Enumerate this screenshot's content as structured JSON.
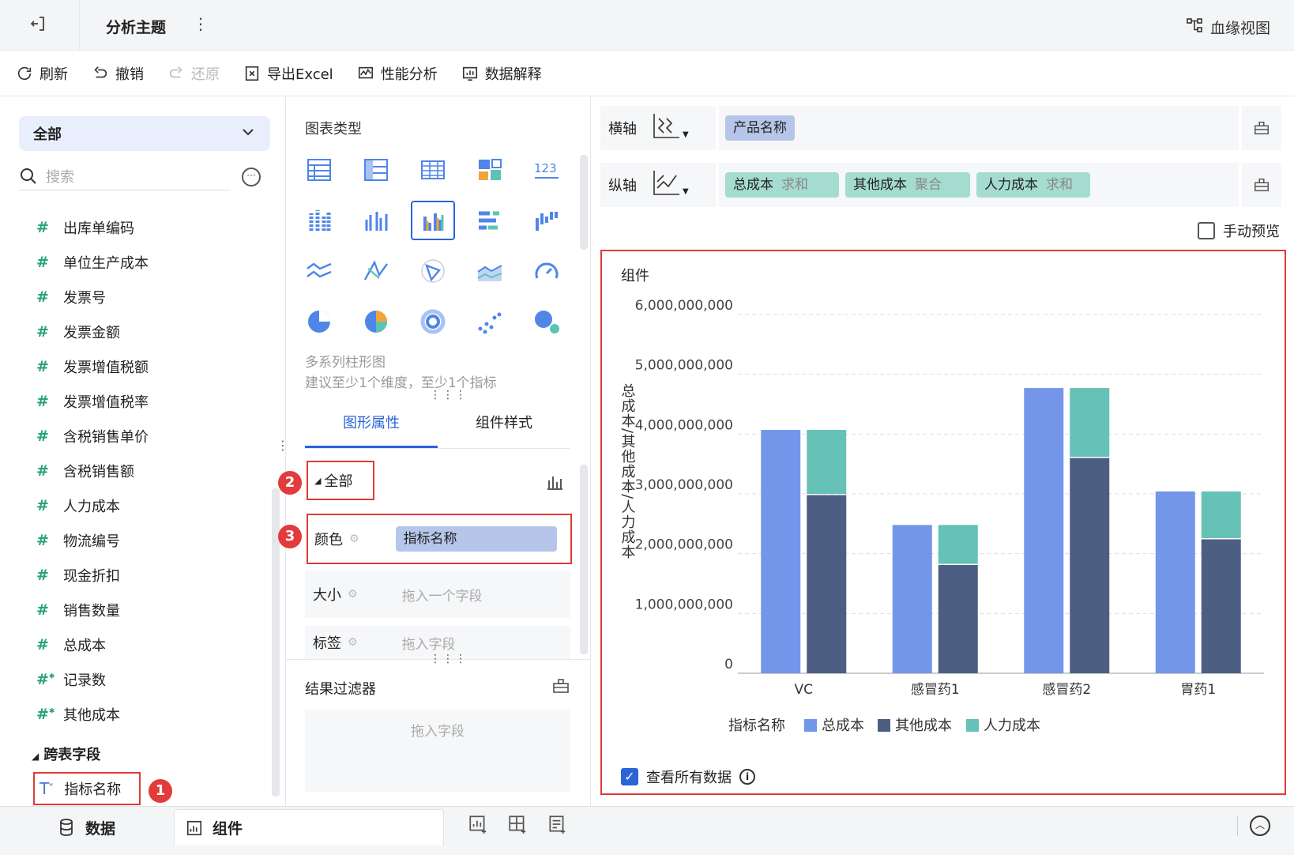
{
  "header": {
    "title": "分析主题",
    "lineage_label": "血缘视图"
  },
  "toolbar": {
    "refresh": "刷新",
    "undo": "撤销",
    "redo": "还原",
    "export": "导出Excel",
    "perf": "性能分析",
    "explain": "数据解释"
  },
  "left": {
    "scope": "全部",
    "search_placeholder": "搜索",
    "fields": [
      {
        "label": "出库单编码",
        "icon": "hash-icon"
      },
      {
        "label": "单位生产成本",
        "icon": "hash-icon"
      },
      {
        "label": "发票号",
        "icon": "hash-icon"
      },
      {
        "label": "发票金额",
        "icon": "hash-icon"
      },
      {
        "label": "发票增值税额",
        "icon": "hash-icon"
      },
      {
        "label": "发票增值税率",
        "icon": "hash-icon"
      },
      {
        "label": "含税销售单价",
        "icon": "hash-icon"
      },
      {
        "label": "含税销售额",
        "icon": "hash-icon"
      },
      {
        "label": "人力成本",
        "icon": "hash-icon"
      },
      {
        "label": "物流编号",
        "icon": "hash-icon"
      },
      {
        "label": "现金折扣",
        "icon": "hash-icon"
      },
      {
        "label": "销售数量",
        "icon": "hash-icon"
      },
      {
        "label": "总成本",
        "icon": "hash-icon"
      },
      {
        "label": "记录数",
        "icon": "hash-calc-icon"
      },
      {
        "label": "其他成本",
        "icon": "hash-calc-icon"
      }
    ],
    "cross_table_title": "跨表字段",
    "cross_field": "指标名称",
    "badge1": "1"
  },
  "middle": {
    "chart_type_title": "图表类型",
    "chart_desc": "多系列柱形图",
    "chart_hint": "建议至少1个维度，至少1个指标",
    "tab_graph": "图形属性",
    "tab_style": "组件样式",
    "all_label": "全部",
    "badge2": "2",
    "badge3": "3",
    "color_label": "颜色",
    "color_value": "指标名称",
    "size_label": "大小",
    "size_placeholder": "拖入一个字段",
    "tag_label": "标签",
    "tag_placeholder": "拖入字段",
    "filter_title": "结果过滤器",
    "filter_placeholder": "拖入字段"
  },
  "right": {
    "x_axis_label": "横轴",
    "x_field": "产品名称",
    "y_axis_label": "纵轴",
    "y_fields": [
      {
        "name": "总成本",
        "agg": "求和"
      },
      {
        "name": "其他成本",
        "agg": "聚合"
      },
      {
        "name": "人力成本",
        "agg": "求和"
      }
    ],
    "manual_preview": "手动预览",
    "component_title": "组件",
    "view_all": "查看所有数据"
  },
  "bottom": {
    "data_tab": "数据",
    "component_tab": "组件"
  },
  "colors": {
    "total": "#7396ea",
    "other": "#4c5f82",
    "labor": "#66c1b6",
    "accent": "#2a64d6"
  },
  "chart_data": {
    "type": "bar",
    "categories": [
      "VC",
      "感冒药1",
      "感冒药2",
      "胃药1"
    ],
    "series": [
      {
        "name": "总成本",
        "values": [
          4070000000,
          2480000000,
          4770000000,
          3040000000
        ],
        "stack": "a"
      },
      {
        "name": "其他成本",
        "values": [
          2980000000,
          1810000000,
          3600000000,
          2240000000
        ],
        "stack": "b"
      },
      {
        "name": "人力成本",
        "values": [
          1090000000,
          670000000,
          1170000000,
          800000000
        ],
        "stack": "b"
      }
    ],
    "ylabel": "总成本/其他成本/人力成本",
    "legend_title": "指标名称",
    "y_ticks": [
      "0",
      "1,000,000,000",
      "2,000,000,000",
      "3,000,000,000",
      "4,000,000,000",
      "5,000,000,000",
      "6,000,000,000"
    ],
    "ylim": [
      0,
      6000000000
    ],
    "grid": true,
    "legend_position": "bottom"
  }
}
